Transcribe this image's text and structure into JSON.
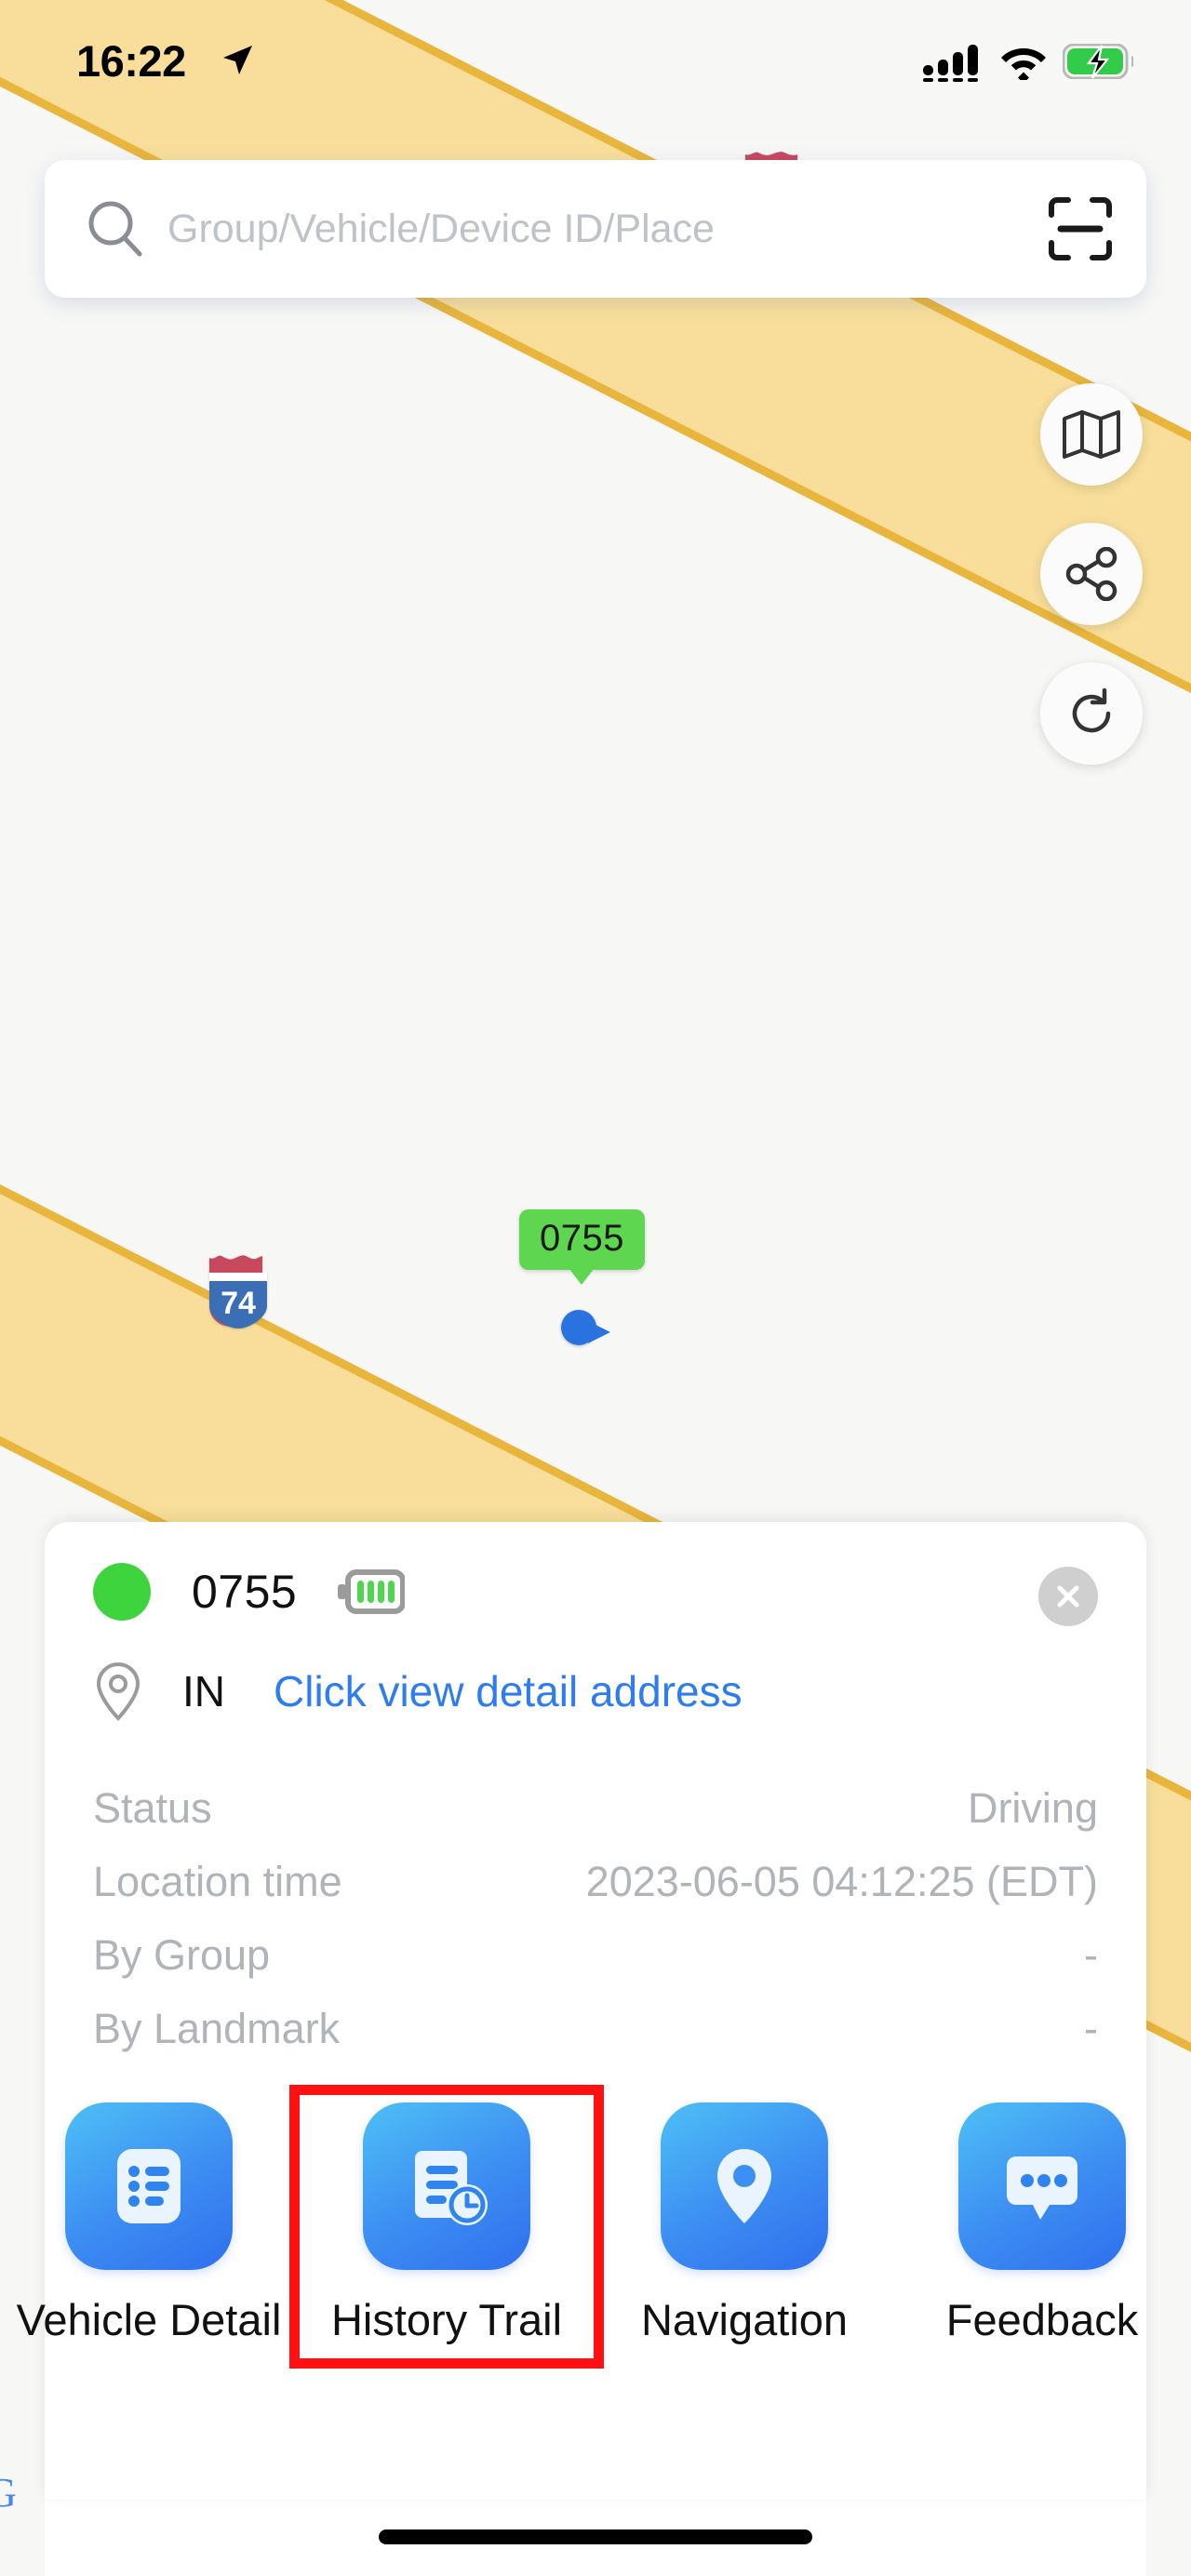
{
  "status_bar": {
    "time": "16:22",
    "location_arrow_icon": "location-arrow-icon",
    "signal_icon": "cellular-signal-icon",
    "wifi_icon": "wifi-icon",
    "battery_icon": "battery-charging-icon"
  },
  "search": {
    "placeholder": "Group/Vehicle/Device ID/Place",
    "value": "",
    "search_icon": "search-icon",
    "scan_icon": "qr-scan-icon"
  },
  "map_controls": [
    {
      "name": "map-layers-button",
      "icon": "map-icon"
    },
    {
      "name": "share-button",
      "icon": "share-icon"
    },
    {
      "name": "refresh-button",
      "icon": "refresh-icon"
    }
  ],
  "map": {
    "highway_shield_label": "74",
    "vehicle_marker_label": "0755",
    "attribution": "G"
  },
  "info_card": {
    "device_id": "0755",
    "status_dot_color": "#3ed43e",
    "battery_icon": "battery-icon",
    "close_icon": "close-icon",
    "location_pin_icon": "location-pin-icon",
    "country": "IN",
    "address_link": "Click view detail address",
    "details": [
      {
        "label": "Status",
        "value": "Driving"
      },
      {
        "label": "Location time",
        "value": "2023-06-05 04:12:25 (EDT)"
      },
      {
        "label": "By Group",
        "value": "-"
      },
      {
        "label": "By Landmark",
        "value": "-"
      }
    ]
  },
  "actions": [
    {
      "label": "Vehicle Detail",
      "icon": "list-document-icon",
      "highlighted": false
    },
    {
      "label": "History Trail",
      "icon": "document-clock-icon",
      "highlighted": true
    },
    {
      "label": "Navigation",
      "icon": "map-pin-icon",
      "highlighted": false
    },
    {
      "label": "Feedback",
      "icon": "chat-bubble-icon",
      "highlighted": false
    }
  ],
  "colors": {
    "accent_blue": "#2e7df0",
    "status_green": "#3ed43e",
    "marker_green": "#5fd64f",
    "highlight_red": "#ff1111",
    "road_fill": "#f8de9a",
    "road_border": "#e8b53d"
  }
}
